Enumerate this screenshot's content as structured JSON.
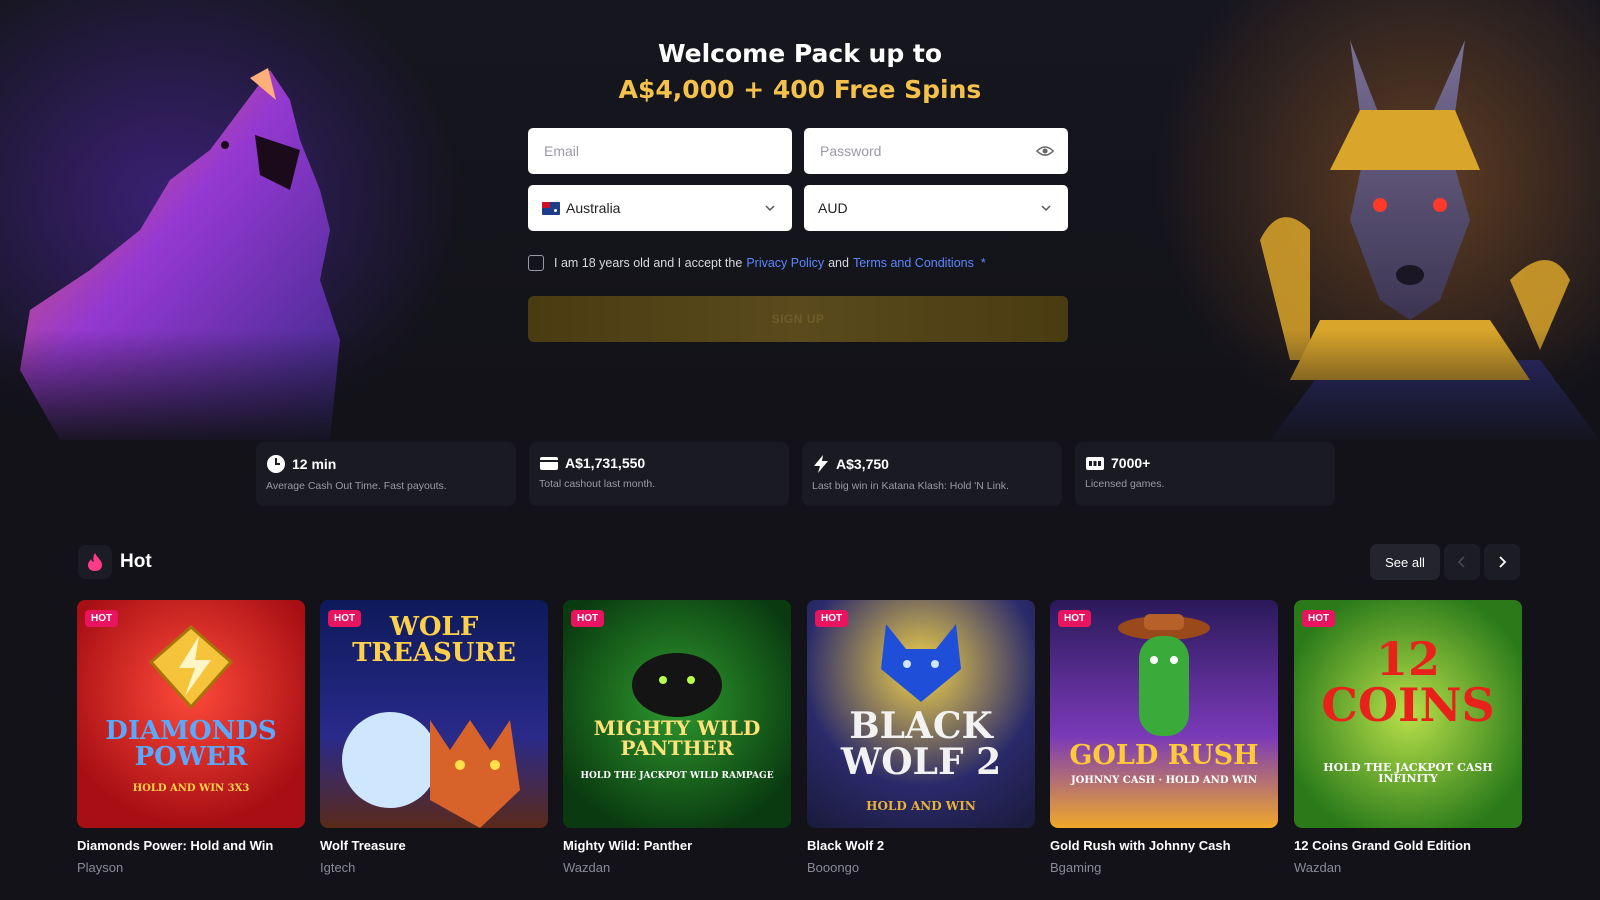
{
  "hero": {
    "title_line1": "Welcome Pack up to",
    "title_line2": "A$4,000 + 400 Free Spins"
  },
  "form": {
    "email_placeholder": "Email",
    "password_placeholder": "Password",
    "country": "Australia",
    "currency": "AUD",
    "agree_prefix": "I am 18 years old and I accept the",
    "privacy_link": "Privacy Policy",
    "agree_and": "and",
    "terms_link": "Terms and Conditions",
    "required_mark": "*",
    "signup_label": "SIGN UP"
  },
  "stats": [
    {
      "value": "12 min",
      "label": "Average Cash Out Time. Fast payouts.",
      "icon": "clock-icon"
    },
    {
      "value": "A$1,731,550",
      "label": "Total cashout last month.",
      "icon": "wallet-icon"
    },
    {
      "value": "A$3,750",
      "label": "Last big win in Katana Klash: Hold 'N Link.",
      "icon": "lightning-icon"
    },
    {
      "value": "7000+",
      "label": "Licensed games.",
      "icon": "slot-machine-icon"
    }
  ],
  "section": {
    "title": "Hot",
    "icon": "flame-icon",
    "see_all": "See all"
  },
  "colors": {
    "accent_gold": "#f4c24a",
    "link_blue": "#5d87ff",
    "hot_tag": "#e8145f"
  },
  "games": [
    {
      "tag": "HOT",
      "title": "Diamonds Power: Hold and Win",
      "provider": "Playson",
      "art_text": "DIAMONDS POWER",
      "art_sub": "HOLD AND WIN 3X3"
    },
    {
      "tag": "HOT",
      "title": "Wolf Treasure",
      "provider": "Igtech",
      "art_text": "WOLF TREASURE",
      "art_sub": ""
    },
    {
      "tag": "HOT",
      "title": "Mighty Wild: Panther",
      "provider": "Wazdan",
      "art_text": "MIGHTY WILD PANTHER",
      "art_sub": "HOLD THE JACKPOT WILD RAMPAGE"
    },
    {
      "tag": "HOT",
      "title": "Black Wolf 2",
      "provider": "Booongo",
      "art_text": "BLACK WOLF 2",
      "art_sub": "HOLD AND WIN"
    },
    {
      "tag": "HOT",
      "title": "Gold Rush with Johnny Cash",
      "provider": "Bgaming",
      "art_text": "GOLD RUSH",
      "art_sub": "JOHNNY CASH · HOLD AND WIN"
    },
    {
      "tag": "HOT",
      "title": "12 Coins Grand Gold Edition",
      "provider": "Wazdan",
      "art_text": "12 COINS",
      "art_sub": "HOLD THE JACKPOT CASH INFINITY"
    }
  ]
}
